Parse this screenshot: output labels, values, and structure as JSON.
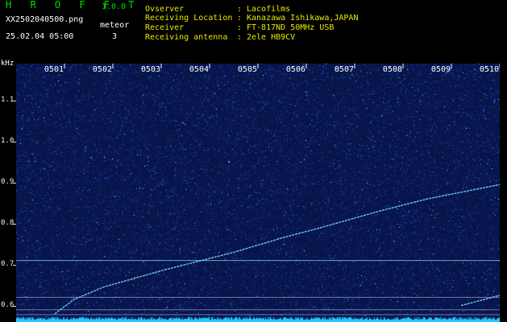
{
  "header": {
    "app_name": "H R O F F T",
    "version": "1.0.0",
    "filename": "XX2502040500.png",
    "datetime": "25.02.04 05:00",
    "detection_type": "meteor",
    "detection_count": "3"
  },
  "station": {
    "observer_label": "Ovserver",
    "observer_value": "Lacofilms",
    "location_label": "Receiving Location",
    "location_value": "Kanazawa Ishikawa,JAPAN",
    "receiver_label": "Receiver",
    "receiver_value": "FT-817ND 50MHz USB",
    "antenna_label": "Receiving antenna",
    "antenna_value": "2ele HB9CV",
    "separator": ":"
  },
  "colors": {
    "background": "#000000",
    "waterfall_base": "#07154a",
    "waterfall_noise": "#2a5cff",
    "signal": "#7fe8ff",
    "header_yellow": "#e8e800",
    "header_green": "#00e000"
  },
  "chart_data": {
    "type": "heatmap",
    "title": "",
    "ylabel": "kHz",
    "xlabel": "",
    "x_tick_labels": [
      "0501",
      "0502",
      "0503",
      "0504",
      "0505",
      "0506",
      "0507",
      "0508",
      "0509",
      "0510"
    ],
    "x_range_minutes": [
      0.0,
      10.0
    ],
    "y_tick_labels": [
      "1.1",
      "1.0",
      "0.9",
      "0.8",
      "0.7",
      "0.6"
    ],
    "ylim_khz": [
      0.56,
      1.19
    ],
    "horizontal_lines_khz": [
      0.71,
      0.62,
      0.59,
      0.578
    ],
    "traces": [
      {
        "points": [
          [
            0.8,
            0.58
          ],
          [
            1.2,
            0.615
          ],
          [
            1.8,
            0.645
          ],
          [
            3.0,
            0.685
          ],
          [
            4.5,
            0.73
          ],
          [
            5.5,
            0.765
          ],
          [
            6.3,
            0.79
          ],
          [
            7.5,
            0.83
          ],
          [
            8.5,
            0.86
          ],
          [
            10.0,
            0.895
          ]
        ]
      },
      {
        "points": [
          [
            9.2,
            0.6
          ],
          [
            10.0,
            0.625
          ]
        ]
      }
    ],
    "grid": false
  }
}
